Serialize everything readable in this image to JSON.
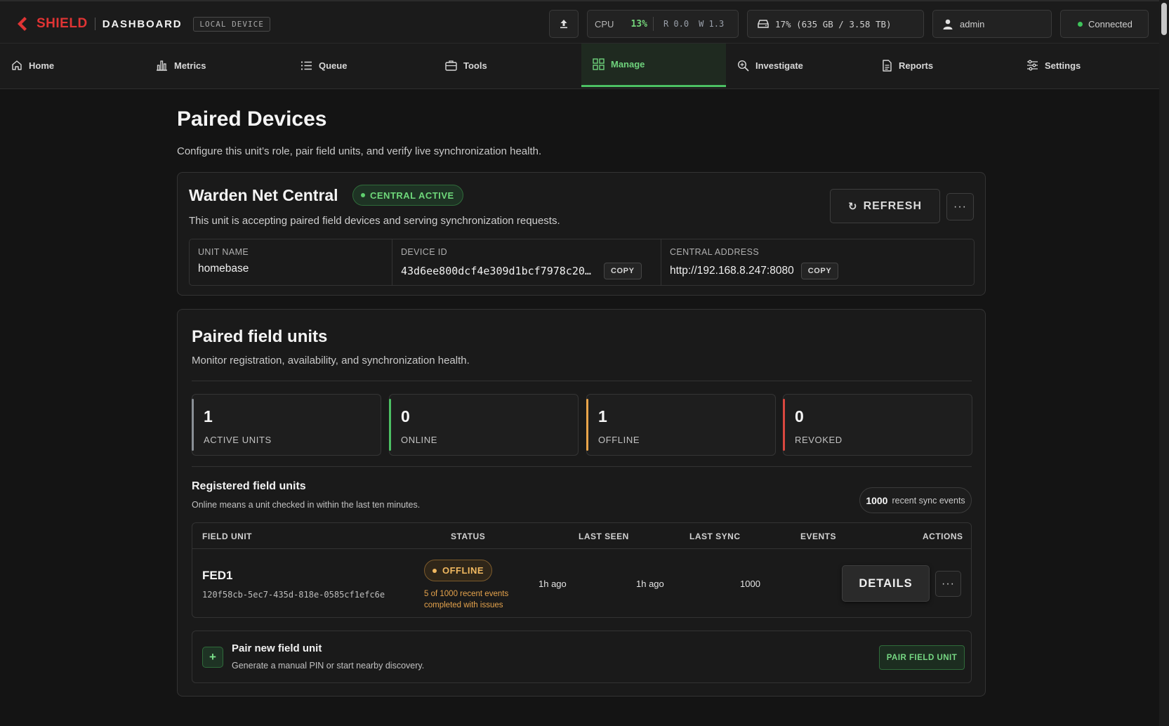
{
  "brand": {
    "name": "SHIELD",
    "section": "DASHBOARD",
    "badge": "LOCAL DEVICE"
  },
  "topbar": {
    "cpu_label": "CPU",
    "cpu_value": "13%",
    "cpu_read": "R 0.0",
    "cpu_write": "W 1.3",
    "disk": "17% (635 GB / 3.58 TB)",
    "user": "admin",
    "connection": "Connected"
  },
  "nav": {
    "items": [
      {
        "label": "Home",
        "icon": "home-icon"
      },
      {
        "label": "Metrics",
        "icon": "bar-chart-icon"
      },
      {
        "label": "Queue",
        "icon": "list-icon"
      },
      {
        "label": "Tools",
        "icon": "briefcase-icon"
      },
      {
        "label": "Manage",
        "icon": "grid-icon",
        "active": true
      },
      {
        "label": "Investigate",
        "icon": "magnify-icon"
      },
      {
        "label": "Reports",
        "icon": "document-icon"
      },
      {
        "label": "Settings",
        "icon": "sliders-icon"
      }
    ]
  },
  "page": {
    "title": "Paired Devices",
    "subtitle": "Configure this unit’s role, pair field units, and verify live synchronization health."
  },
  "central": {
    "name": "Warden Net Central",
    "badge": "CENTRAL ACTIVE",
    "description": "This unit is accepting paired field devices and serving synchronization requests.",
    "refresh_label": "REFRESH",
    "more_label": "···",
    "fields": {
      "unit_name_label": "UNIT NAME",
      "unit_name": "homebase",
      "device_id_label": "DEVICE ID",
      "device_id": "43d6ee800dcf4e309d1bcf7978c20…",
      "central_address_label": "CENTRAL ADDRESS",
      "central_address": "http://192.168.8.247:8080",
      "copy_label": "COPY"
    }
  },
  "field_units": {
    "title": "Paired field units",
    "subtitle": "Monitor registration, availability, and synchronization health.",
    "stats": [
      {
        "value": "1",
        "label": "ACTIVE UNITS",
        "color": "#8a8f96"
      },
      {
        "value": "0",
        "label": "ONLINE",
        "color": "#4cc063"
      },
      {
        "value": "1",
        "label": "OFFLINE",
        "color": "#e9a54a"
      },
      {
        "value": "0",
        "label": "REVOKED",
        "color": "#d9473f"
      }
    ],
    "registered_title": "Registered field units",
    "registered_sub": "Online means a unit checked in within the last ten minutes.",
    "sync_count": "1000",
    "sync_label": "recent sync events",
    "columns": [
      "FIELD UNIT",
      "STATUS",
      "LAST SEEN",
      "LAST SYNC",
      "EVENTS",
      "ACTIONS"
    ],
    "rows": [
      {
        "name": "FED1",
        "id": "120f58cb-5ec7-435d-818e-0585cf1efc6e",
        "status": "OFFLINE",
        "status_note": "5 of 1000 recent events completed with issues",
        "last_seen": "1h ago",
        "last_sync": "1h ago",
        "events": "1000",
        "details_label": "DETAILS",
        "more_label": "···"
      }
    ],
    "pair": {
      "title": "Pair new field unit",
      "subtitle": "Generate a manual PIN or start nearby discovery.",
      "button_label": "PAIR FIELD UNIT",
      "plus": "+"
    }
  }
}
